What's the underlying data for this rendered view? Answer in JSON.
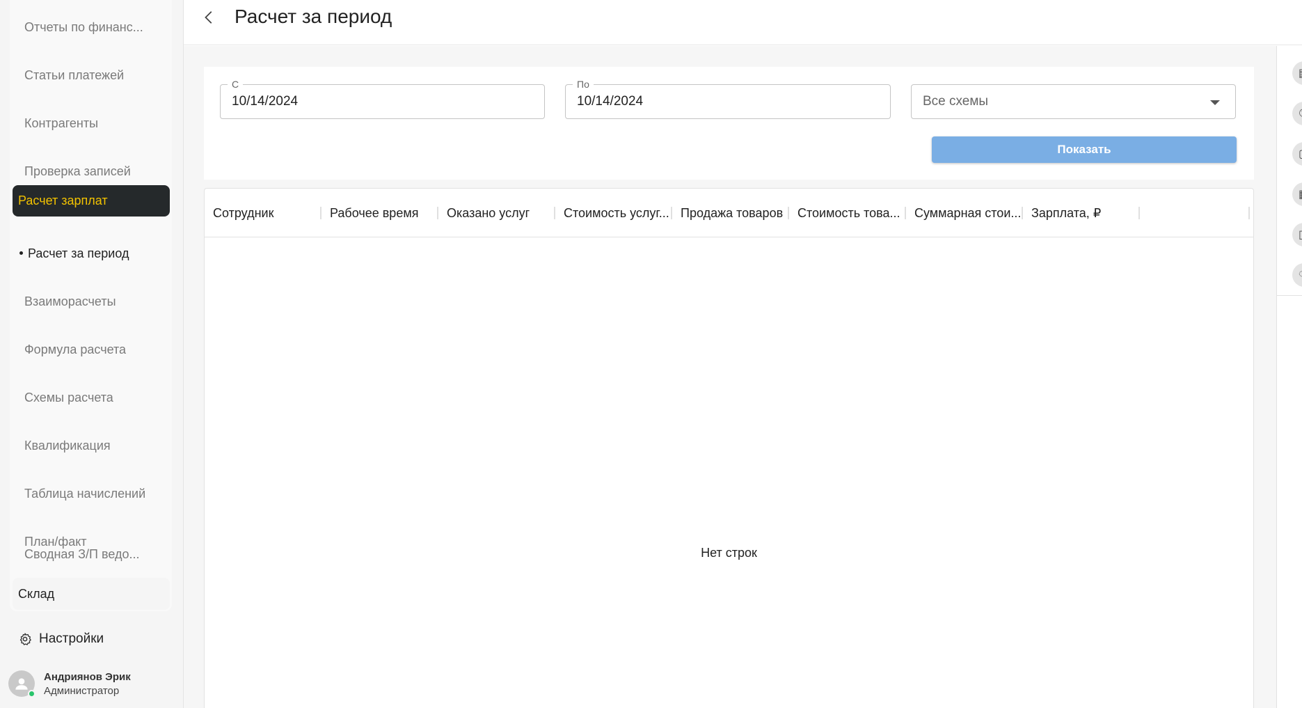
{
  "sidebar": {
    "items": [
      {
        "label": "Отчеты по финанс..."
      },
      {
        "label": "Статьи платежей"
      },
      {
        "label": "Контрагенты"
      },
      {
        "label": "Проверка записей"
      }
    ],
    "active_section": "Расчет зарплат",
    "active_child": "Расчет за период",
    "items_after": [
      {
        "label": "Взаиморасчеты"
      },
      {
        "label": "Формула расчета"
      },
      {
        "label": "Схемы расчета"
      },
      {
        "label": "Квалификация"
      },
      {
        "label": "Таблица начислений"
      },
      {
        "label": "План/факт"
      },
      {
        "label": "Сводная З/П ведо..."
      }
    ],
    "sklad": "Склад",
    "settings": "Настройки",
    "user": {
      "name": "Андриянов Эрик",
      "role": "Администратор"
    }
  },
  "header": {
    "title": "Расчет за период"
  },
  "filters": {
    "from": {
      "label": "С",
      "value": "10/14/2024"
    },
    "to": {
      "label": "По",
      "value": "10/14/2024"
    },
    "scheme": {
      "value": "Все схемы"
    },
    "show_button": "Показать"
  },
  "table": {
    "columns": [
      "Сотрудник",
      "Рабочее время",
      "Оказано услуг",
      "Стоимость услуг...",
      "Продажа товаров",
      "Стоимость това...",
      "Суммарная стои...",
      "Зарплата, ₽"
    ],
    "empty_text": "Нет строк"
  },
  "colors": {
    "active_bg": "#25292b",
    "active_text": "#f2c200",
    "button": "#7aaee4"
  }
}
